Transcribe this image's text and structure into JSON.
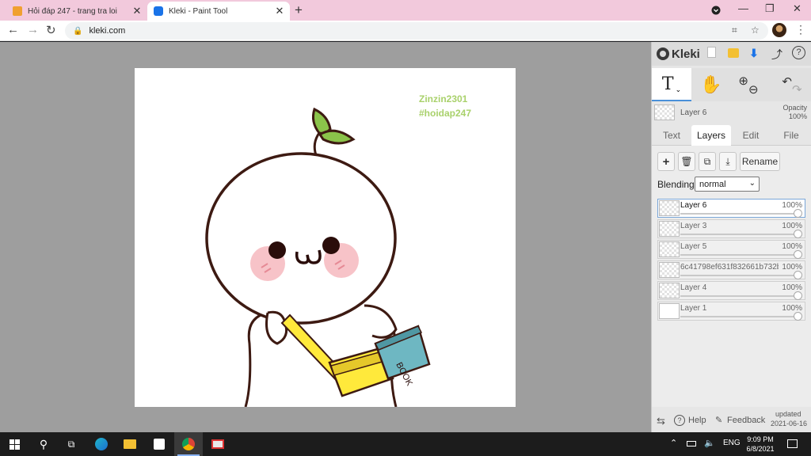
{
  "browser": {
    "tabs": [
      {
        "title": "Hỏi đáp 247 - trang tra loi",
        "close": "✕"
      },
      {
        "title": "Kleki - Paint Tool",
        "close": "✕"
      }
    ],
    "new_tab": "+",
    "url": "kleki.com",
    "accent": "#f2c9dc"
  },
  "canvas": {
    "watermark_line1": "Zinzin2301",
    "watermark_line2": "#hoidap247",
    "book_text": "BOOK"
  },
  "panel": {
    "brand": "Kleki",
    "current_layer": {
      "name": "Layer 6",
      "opacity_label": "Opacity",
      "opacity_value": "100%"
    },
    "tabs": [
      "Text",
      "Layers",
      "Edit",
      "File"
    ],
    "rename_label": "Rename",
    "blending_label": "Blending",
    "blending_value": "normal",
    "layers": [
      {
        "name": "Layer 6",
        "opacity": "100%",
        "selected": true
      },
      {
        "name": "Layer 3",
        "opacity": "100%",
        "selected": false
      },
      {
        "name": "Layer 5",
        "opacity": "100%",
        "selected": false
      },
      {
        "name": "6c41798ef631f832661b732b5",
        "opacity": "100%",
        "selected": false
      },
      {
        "name": "Layer 4",
        "opacity": "100%",
        "selected": false
      },
      {
        "name": "Layer 1",
        "opacity": "100%",
        "selected": false
      }
    ],
    "footer": {
      "help": "Help",
      "feedback": "Feedback",
      "updated_label": "updated",
      "updated_date": "2021-06-16"
    }
  },
  "taskbar": {
    "lang": "ENG",
    "time": "9:09 PM",
    "date": "6/8/2021"
  }
}
